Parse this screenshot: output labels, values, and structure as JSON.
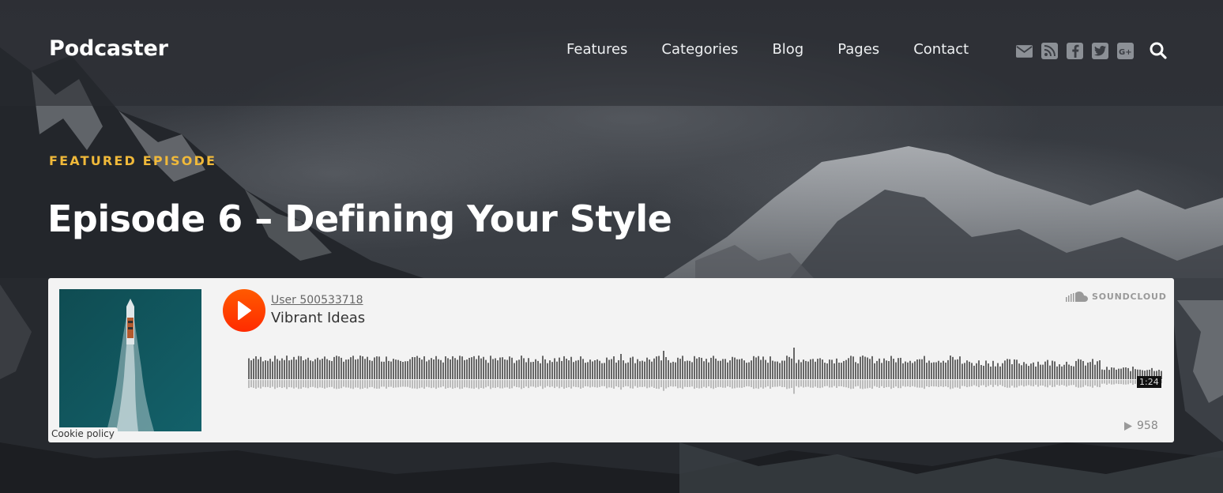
{
  "brand": {
    "name": "Podcaster"
  },
  "nav": {
    "items": [
      {
        "label": "Features"
      },
      {
        "label": "Categories"
      },
      {
        "label": "Blog"
      },
      {
        "label": "Pages"
      },
      {
        "label": "Contact"
      }
    ]
  },
  "social": [
    "envelope-icon",
    "rss-icon",
    "facebook-icon",
    "twitter-icon",
    "google-plus-icon"
  ],
  "featured": {
    "eyebrow": "FEATURED EPISODE",
    "title": "Episode 6 – Defining Your Style"
  },
  "player": {
    "uploader": "User 500533718",
    "track_title": "Vibrant Ideas",
    "brand": "SOUNDCLOUD",
    "duration": "1:24",
    "play_count": "958",
    "cookie_label": "Cookie policy"
  },
  "colors": {
    "accent": "#f0b93a",
    "soundcloud_orange": "#ff4400",
    "player_bg": "#f3f3f3",
    "waveform": "#666666"
  }
}
